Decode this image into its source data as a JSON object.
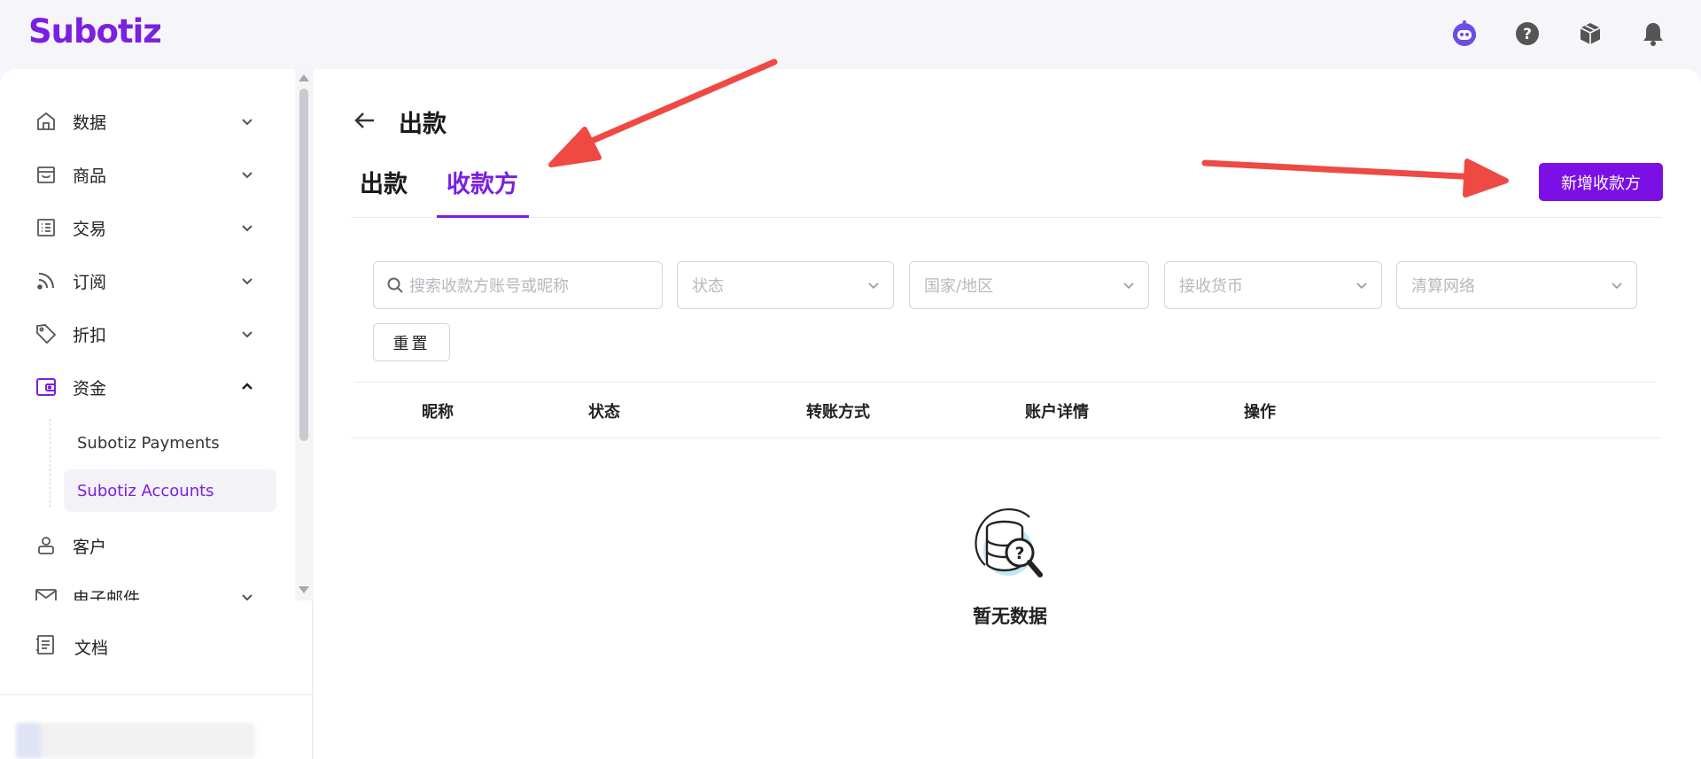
{
  "app": {
    "logo_text": "Subotiz",
    "brand_color": "#7b1fe0"
  },
  "header": {
    "icons": [
      "assistant-bot-icon",
      "help-icon",
      "package-icon",
      "bell-icon"
    ]
  },
  "sidebar": {
    "items": [
      {
        "label": "数据",
        "icon": "home-icon",
        "expanded": false
      },
      {
        "label": "商品",
        "icon": "store-icon",
        "expanded": false
      },
      {
        "label": "交易",
        "icon": "list-icon",
        "expanded": false
      },
      {
        "label": "订阅",
        "icon": "rss-icon",
        "expanded": false
      },
      {
        "label": "折扣",
        "icon": "tag-icon",
        "expanded": false
      },
      {
        "label": "资金",
        "icon": "wallet-icon",
        "expanded": true
      },
      {
        "label": "客户",
        "icon": "user-icon"
      },
      {
        "label": "电子邮件",
        "icon": "mail-icon",
        "expanded": false
      }
    ],
    "sub_items": [
      {
        "label": "Subotiz Payments",
        "active": false
      },
      {
        "label": "Subotiz Accounts",
        "active": true
      }
    ],
    "docs_label": "文档"
  },
  "main": {
    "page_title": "出款",
    "tabs": [
      {
        "label": "出款",
        "active": false
      },
      {
        "label": "收款方",
        "active": true
      }
    ],
    "add_button_label": "新增收款方",
    "filters": {
      "search_placeholder": "搜索收款方账号或昵称",
      "status_placeholder": "状态",
      "country_placeholder": "国家/地区",
      "currency_placeholder": "接收货币",
      "network_placeholder": "清算网络"
    },
    "reset_label": "重置",
    "table": {
      "columns": [
        "昵称",
        "状态",
        "转账方式",
        "账户详情",
        "操作"
      ],
      "rows": []
    },
    "empty_text": "暂无数据"
  }
}
